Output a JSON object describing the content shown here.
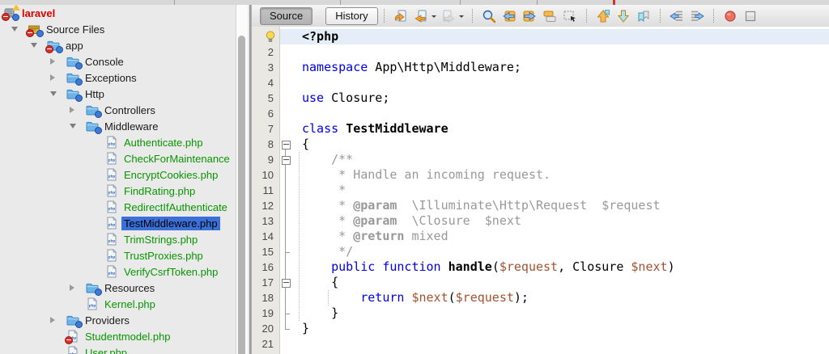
{
  "colors": {
    "keyword_blue": "#0000e6",
    "variable_brown": "#a5512d",
    "comment_gray": "#999999",
    "file_green": "#089600",
    "project_red": "#e00000",
    "selection_blue": "#3a70d8",
    "current_line_blue": "#e5edf9",
    "record_red": "#ef7063"
  },
  "project_tree": {
    "items": [
      {
        "label": "laravel",
        "type": "project",
        "level": 0,
        "expanded": true,
        "color": "red",
        "badges": [
          "warning",
          "error",
          "info"
        ]
      },
      {
        "label": "Source Files",
        "type": "package",
        "level": 1,
        "expanded": true,
        "badges": [
          "error",
          "info"
        ]
      },
      {
        "label": "app",
        "type": "folder",
        "level": 2,
        "expanded": true,
        "badges": [
          "error",
          "info"
        ]
      },
      {
        "label": "Console",
        "type": "folder",
        "level": 3,
        "expanded": false,
        "badges": [
          "info"
        ]
      },
      {
        "label": "Exceptions",
        "type": "folder",
        "level": 3,
        "expanded": false,
        "badges": [
          "info"
        ]
      },
      {
        "label": "Http",
        "type": "folder",
        "level": 3,
        "expanded": true,
        "badges": [
          "info"
        ]
      },
      {
        "label": "Controllers",
        "type": "folder",
        "level": 4,
        "expanded": false,
        "badges": [
          "info"
        ]
      },
      {
        "label": "Middleware",
        "type": "folder",
        "level": 4,
        "expanded": true,
        "badges": [
          "info"
        ]
      },
      {
        "label": "Authenticate.php",
        "type": "file",
        "level": 5,
        "color": "green"
      },
      {
        "label": "CheckForMaintenance",
        "type": "file",
        "level": 5,
        "color": "green"
      },
      {
        "label": "EncryptCookies.php",
        "type": "file",
        "level": 5,
        "color": "green"
      },
      {
        "label": "FindRating.php",
        "type": "file",
        "level": 5,
        "color": "green"
      },
      {
        "label": "RedirectIfAuthenticate",
        "type": "file",
        "level": 5,
        "color": "green"
      },
      {
        "label": "TestMiddleware.php",
        "type": "file",
        "level": 5,
        "color": "green",
        "selected": true
      },
      {
        "label": "TrimStrings.php",
        "type": "file",
        "level": 5,
        "color": "green"
      },
      {
        "label": "TrustProxies.php",
        "type": "file",
        "level": 5,
        "color": "green"
      },
      {
        "label": "VerifyCsrfToken.php",
        "type": "file",
        "level": 5,
        "color": "green"
      },
      {
        "label": "Resources",
        "type": "folder",
        "level": 4,
        "expanded": false,
        "badges": [
          "info"
        ]
      },
      {
        "label": "Kernel.php",
        "type": "file",
        "level": 4,
        "color": "green"
      },
      {
        "label": "Providers",
        "type": "folder",
        "level": 3,
        "expanded": false,
        "badges": [
          "info"
        ]
      },
      {
        "label": "Studentmodel.php",
        "type": "file",
        "level": 3,
        "color": "green",
        "badges": [
          "error"
        ]
      },
      {
        "label": "User.php",
        "type": "file",
        "level": 3,
        "color": "green"
      }
    ]
  },
  "editor_toolbar": {
    "source_button": "Source",
    "history_button": "History",
    "icons": [
      {
        "sep": true
      },
      {
        "name": "jump-last-edit-icon"
      },
      {
        "name": "back-icon",
        "caret": true
      },
      {
        "name": "forward-icon",
        "caret": true,
        "disabled": true
      },
      {
        "sep": true
      },
      {
        "name": "find-icon"
      },
      {
        "name": "find-previous-icon"
      },
      {
        "name": "find-next-icon"
      },
      {
        "name": "toggle-highlight-search-icon"
      },
      {
        "name": "rectangular-selection-icon"
      },
      {
        "sep": true
      },
      {
        "name": "previous-bookmark-icon"
      },
      {
        "name": "next-bookmark-icon"
      },
      {
        "name": "toggle-bookmark-icon"
      },
      {
        "sep": true
      },
      {
        "name": "shift-line-left-icon"
      },
      {
        "name": "shift-line-right-icon"
      },
      {
        "sep": true
      },
      {
        "name": "record-macro-icon"
      },
      {
        "name": "stop-macro-icon"
      }
    ]
  },
  "editor": {
    "current_line": 1,
    "visible_lines": 21,
    "gutter_line1_glyph": "hint-lightbulb-icon",
    "folds": {
      "boxes": [
        8,
        9,
        17
      ],
      "ranges": [
        [
          8,
          20
        ],
        [
          9,
          15
        ],
        [
          17,
          19
        ]
      ]
    },
    "lines": [
      [
        [
          "<?php",
          "b"
        ]
      ],
      [],
      [
        [
          "namespace",
          "k"
        ],
        [
          " App\\Http\\Middleware;",
          "p"
        ]
      ],
      [],
      [
        [
          "use",
          "k"
        ],
        [
          " Closure;",
          "p"
        ]
      ],
      [],
      [
        [
          "class",
          "k"
        ],
        [
          " ",
          "p"
        ],
        [
          "TestMiddleware",
          "b"
        ]
      ],
      [
        [
          "{",
          "p"
        ]
      ],
      [
        [
          "    /**",
          "c"
        ]
      ],
      [
        [
          "     * Handle an incoming request.",
          "c"
        ]
      ],
      [
        [
          "     *",
          "c"
        ]
      ],
      [
        [
          "     * ",
          "c"
        ],
        [
          "@param",
          "cb"
        ],
        [
          "  \\Illuminate\\Http\\Request  $request",
          "c"
        ]
      ],
      [
        [
          "     * ",
          "c"
        ],
        [
          "@param",
          "cb"
        ],
        [
          "  \\Closure  $next",
          "c"
        ]
      ],
      [
        [
          "     * ",
          "c"
        ],
        [
          "@return",
          "cb"
        ],
        [
          " mixed",
          "c"
        ]
      ],
      [
        [
          "     */",
          "c"
        ]
      ],
      [
        [
          "    ",
          "p"
        ],
        [
          "public",
          "k"
        ],
        [
          " ",
          "p"
        ],
        [
          "function",
          "k"
        ],
        [
          " ",
          "p"
        ],
        [
          "handle",
          "b"
        ],
        [
          "(",
          "p"
        ],
        [
          "$request",
          "v"
        ],
        [
          ", Closure ",
          "p"
        ],
        [
          "$next",
          "v"
        ],
        [
          ")",
          "p"
        ]
      ],
      [
        [
          "    {",
          "p"
        ]
      ],
      [
        [
          "        ",
          "p"
        ],
        [
          "return",
          "k"
        ],
        [
          " ",
          "p"
        ],
        [
          "$next",
          "v"
        ],
        [
          "(",
          "p"
        ],
        [
          "$request",
          "v"
        ],
        [
          ");",
          "p"
        ]
      ],
      [
        [
          "    }",
          "p"
        ]
      ],
      [
        [
          "}",
          "p"
        ]
      ],
      []
    ]
  }
}
